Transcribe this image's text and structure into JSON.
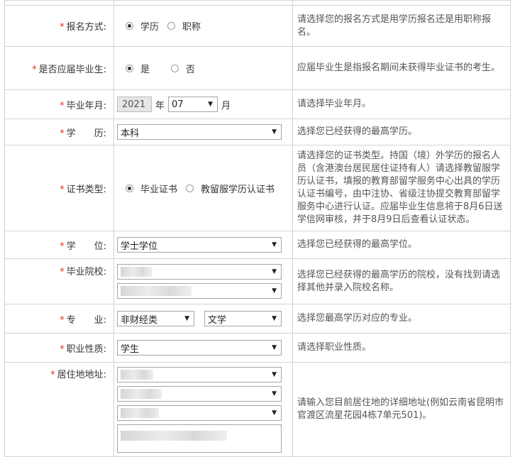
{
  "form": {
    "apply_method": {
      "label": "报名方式:",
      "options": [
        "学历",
        "职称"
      ],
      "selected_index": 0,
      "hint": "请选择您的报名方式是用学历报名还是用职称报名。"
    },
    "graduate": {
      "label": "是否应届毕业生:",
      "options": [
        "是",
        "否"
      ],
      "selected_index": 0,
      "hint": "应届毕业生是指报名期间未获得毕业证书的考生。"
    },
    "grad_date": {
      "label": "毕业年月:",
      "year": "2021",
      "year_unit": "年",
      "month": "07",
      "month_unit": "月",
      "hint": "请选择毕业年月。"
    },
    "education": {
      "label": "学　　历:",
      "value": "本科",
      "hint": "选择您已经获得的最高学历。"
    },
    "cert_type": {
      "label": "证书类型:",
      "options": [
        "毕业证书",
        "教留服学历认证书"
      ],
      "selected_index": 0,
      "hint": "请选择您的证书类型。持国（境）外学历的报名人员（含港澳台居民居住证持有人）请选择教留服学历认证书，填报的教育部留学服务中心出具的学历认证书编号，由中注协、省级注协提交教育部留学服务中心进行认证。应届毕业生信息将于8月6日送学信网审核，并于8月9日后查看认证状态。"
    },
    "degree": {
      "label": "学　　位:",
      "value": "学士学位",
      "hint": "选择您已经获得的最高学位。"
    },
    "school": {
      "label": "毕业院校:",
      "hint": "选择您已经获得的最高学历的院校，没有找到请选择其他并录入院校名称。"
    },
    "major": {
      "label": "专　　业:",
      "category": "非财经类",
      "field": "文学",
      "hint": "选择您最高学历对应的专业。"
    },
    "occupation": {
      "label": "职业性质:",
      "value": "学生",
      "hint": "请选择职业性质。"
    },
    "address": {
      "label": "居住地地址:",
      "hint": "请输入您目前居住地的详细地址(例如云南省昆明市官渡区流星花园4栋7单元501)。"
    },
    "required_mark": "*",
    "select_arrow": "▼"
  }
}
